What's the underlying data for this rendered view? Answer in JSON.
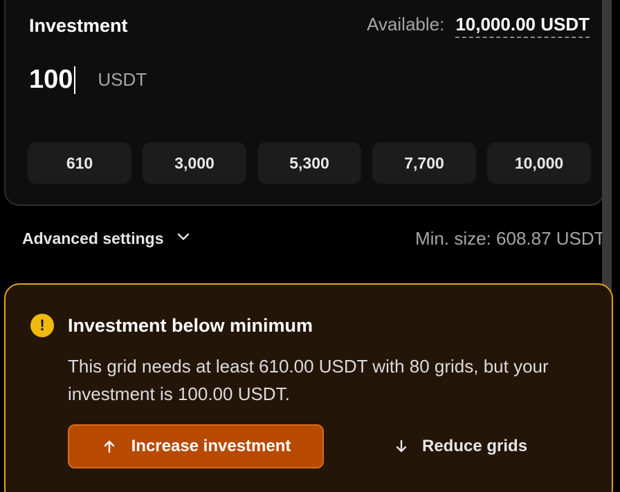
{
  "investment": {
    "title": "Investment",
    "available_label": "Available:",
    "available_value": "10,000.00 USDT",
    "amount": "100",
    "unit": "USDT",
    "presets": [
      "610",
      "3,000",
      "5,300",
      "7,700",
      "10,000"
    ]
  },
  "advanced": {
    "label": "Advanced settings",
    "min_size": "Min. size: 608.87 USDT"
  },
  "warning": {
    "icon": "!",
    "title": "Investment below minimum",
    "message": "This grid needs at least 610.00 USDT with 80 grids, but your investment is 100.00 USDT.",
    "increase_label": "Increase investment",
    "reduce_label": "Reduce grids"
  },
  "colors": {
    "accent_button": "#b84a00",
    "warning_border": "#e3a321",
    "warning_icon": "#f0b90b"
  }
}
